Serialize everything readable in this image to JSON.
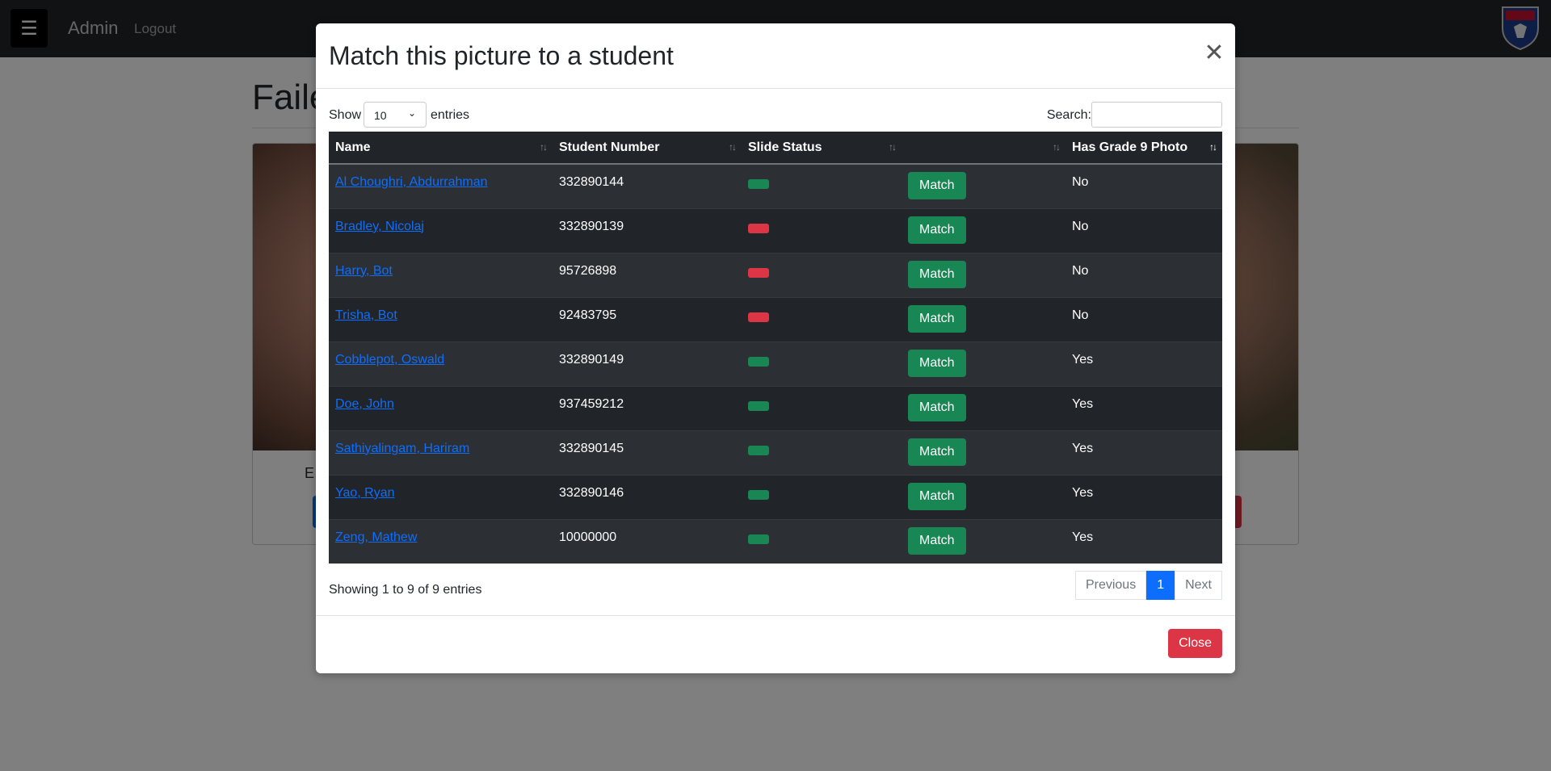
{
  "navbar": {
    "menu_icon": "hamburger-icon",
    "brand": "Admin",
    "logout": "Logout",
    "crest_icon": "school-crest-icon"
  },
  "page": {
    "title": "Faile",
    "caption": "E"
  },
  "modal": {
    "title": "Match this picture to a student",
    "close_icon": "close-icon",
    "show_label": "Show",
    "page_length": "10",
    "entries_label": "entries",
    "search_label": "Search:",
    "search_value": "",
    "columns": [
      "Name",
      "Student Number",
      "Slide Status",
      "",
      "Has Grade 9 Photo"
    ],
    "rows": [
      {
        "name": "Al Choughri, Abdurrahman",
        "number": "332890144",
        "status": "green",
        "action": "Match",
        "grade9": "No"
      },
      {
        "name": "Bradley, Nicolaj",
        "number": "332890139",
        "status": "red",
        "action": "Match",
        "grade9": "No"
      },
      {
        "name": "Harry, Bot",
        "number": "95726898",
        "status": "red",
        "action": "Match",
        "grade9": "No"
      },
      {
        "name": "Trisha, Bot",
        "number": "92483795",
        "status": "red",
        "action": "Match",
        "grade9": "No"
      },
      {
        "name": "Cobblepot, Oswald",
        "number": "332890149",
        "status": "green",
        "action": "Match",
        "grade9": "Yes"
      },
      {
        "name": "Doe, John",
        "number": "937459212",
        "status": "green",
        "action": "Match",
        "grade9": "Yes"
      },
      {
        "name": "Sathiyalingam, Hariram",
        "number": "332890145",
        "status": "green",
        "action": "Match",
        "grade9": "Yes"
      },
      {
        "name": "Yao, Ryan",
        "number": "332890146",
        "status": "green",
        "action": "Match",
        "grade9": "Yes"
      },
      {
        "name": "Zeng, Mathew",
        "number": "10000000",
        "status": "green",
        "action": "Match",
        "grade9": "Yes"
      }
    ],
    "info": "Showing 1 to 9 of 9 entries",
    "pagination": {
      "previous": "Previous",
      "current": "1",
      "next": "Next"
    },
    "close_button": "Close"
  },
  "colors": {
    "status_green": "#198754",
    "status_red": "#dc3545",
    "link": "#0d6efd"
  }
}
